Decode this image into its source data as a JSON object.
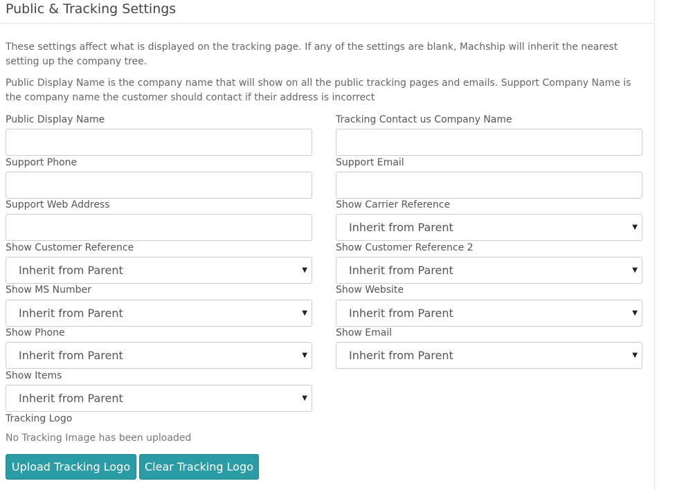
{
  "panel": {
    "title": "Public & Tracking Settings",
    "description_1": "These settings affect what is displayed on the tracking page. If any of the settings are blank, Machship will inherit the nearest setting up the company tree.",
    "description_2": "Public Display Name is the company name that will show on all the public tracking pages and emails. Support Company Name is the company name the customer should contact if their address is incorrect"
  },
  "fields": {
    "public_display_name": {
      "label": "Public Display Name",
      "value": ""
    },
    "tracking_contact_company": {
      "label": "Tracking Contact us Company Name",
      "value": ""
    },
    "support_phone": {
      "label": "Support Phone",
      "value": ""
    },
    "support_email": {
      "label": "Support Email",
      "value": ""
    },
    "support_web_address": {
      "label": "Support Web Address",
      "value": ""
    },
    "show_carrier_reference": {
      "label": "Show Carrier Reference",
      "value": "Inherit from Parent"
    },
    "show_customer_reference": {
      "label": "Show Customer Reference",
      "value": "Inherit from Parent"
    },
    "show_customer_reference_2": {
      "label": "Show Customer Reference 2",
      "value": "Inherit from Parent"
    },
    "show_ms_number": {
      "label": "Show MS Number",
      "value": "Inherit from Parent"
    },
    "show_website": {
      "label": "Show Website",
      "value": "Inherit from Parent"
    },
    "show_phone": {
      "label": "Show Phone",
      "value": "Inherit from Parent"
    },
    "show_email": {
      "label": "Show Email",
      "value": "Inherit from Parent"
    },
    "show_items": {
      "label": "Show Items",
      "value": "Inherit from Parent"
    }
  },
  "tracking_logo": {
    "label": "Tracking Logo",
    "status": "No Tracking Image has been uploaded",
    "upload_label": "Upload Tracking Logo",
    "clear_label": "Clear Tracking Logo"
  },
  "icons": {
    "select_caret": "caret-down-icon"
  },
  "colors": {
    "button_bg": "#2a9ca5",
    "button_text": "#ffffff"
  }
}
